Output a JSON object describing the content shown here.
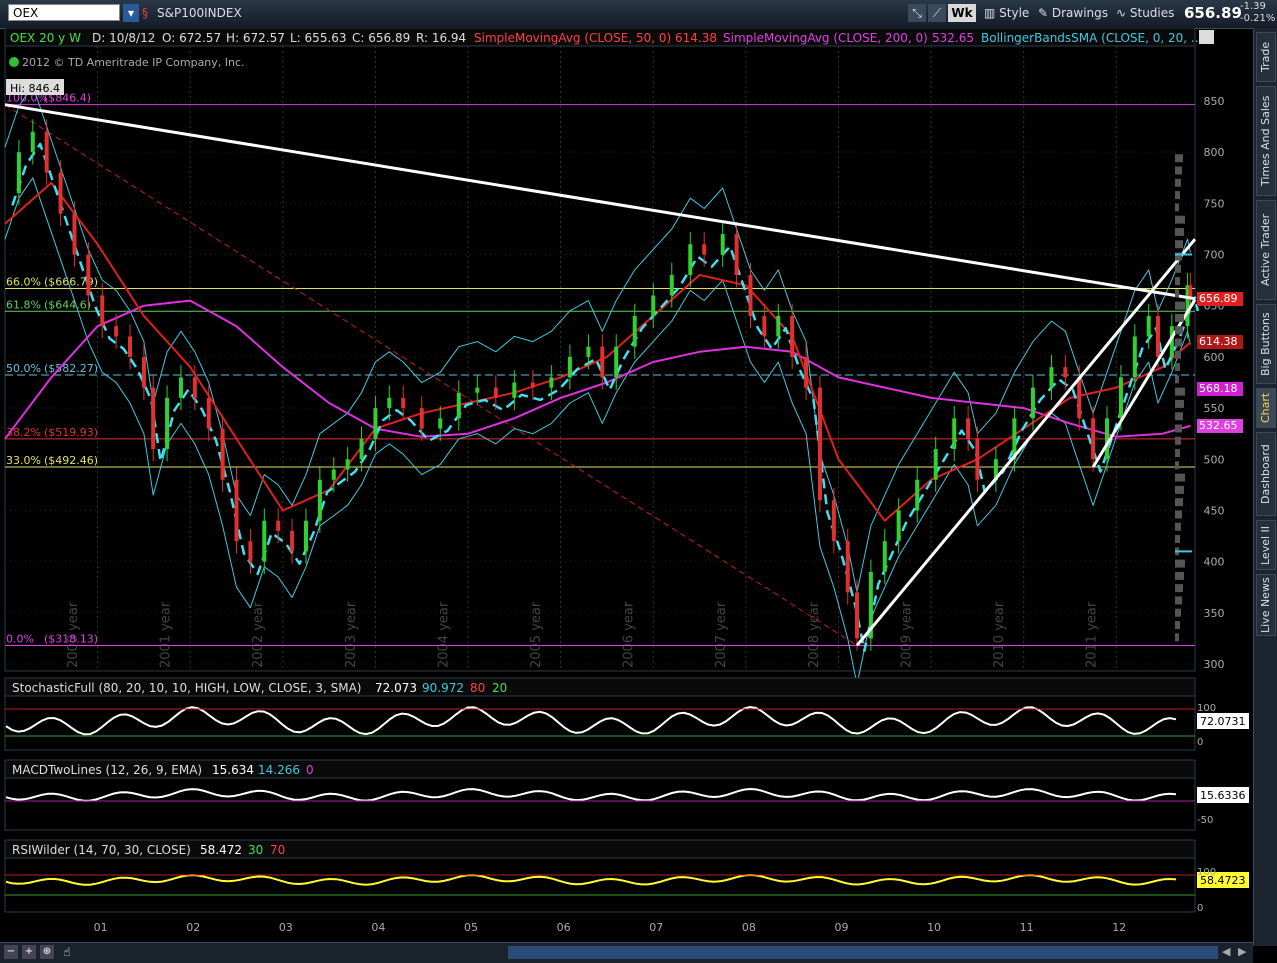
{
  "toolbar": {
    "symbol": "OEX",
    "description": "S&P100INDEX",
    "wk_label": "Wk",
    "style_label": "Style",
    "drawings_label": "Drawings",
    "studies_label": "Studies",
    "last_price": "656.89",
    "change": "-1.39",
    "change_pct": "-0.21%"
  },
  "header": {
    "title": "OEX 20 y W",
    "date": "D: 10/8/12",
    "open": "O: 672.57",
    "high": "H: 672.57",
    "low": "L: 655.63",
    "close": "C: 656.89",
    "range": "R: 16.94",
    "sma50_label": "SimpleMovingAvg (CLOSE, 50, 0)",
    "sma50_value": "614.38",
    "sma200_label": "SimpleMovingAvg (CLOSE, 200, 0)",
    "sma200_value": "532.65",
    "bb_label": "BollingerBandsSMA (CLOSE, 0, 20, ...",
    "copyright": "2012 © TD Ameritrade IP Company, Inc.",
    "hi_label": "Hi: 846.4"
  },
  "fib_levels": [
    {
      "label": "100.0%",
      "value": "($846.4)",
      "price": 846.4,
      "color": "#e040e0"
    },
    {
      "label": "66.0%",
      "value": "($666.79)",
      "price": 666.79,
      "color": "#e0e060"
    },
    {
      "label": "61.8%",
      "value": "($644.6)",
      "price": 644.6,
      "color": "#60d060"
    },
    {
      "label": "50.0%",
      "value": "($582.27)",
      "price": 582.27,
      "color": "#60c0e0"
    },
    {
      "label": "38.2%",
      "value": "($519.93)",
      "price": 519.93,
      "color": "#e03030"
    },
    {
      "label": "33.0%",
      "value": "($492.46)",
      "price": 492.46,
      "color": "#e0e060"
    },
    {
      "label": "0.0%",
      "value": "($318.13)",
      "price": 318.13,
      "color": "#e040e0"
    }
  ],
  "price_tags": [
    {
      "text": "656.89",
      "price": 656.89,
      "bg": "#e02020",
      "fg": "#ffffff"
    },
    {
      "text": "614.38",
      "price": 614.38,
      "bg": "#b01818",
      "fg": "#ffffff"
    },
    {
      "text": "568.18",
      "price": 568.18,
      "bg": "#d020d0",
      "fg": "#ffffff"
    },
    {
      "text": "532.65",
      "price": 532.65,
      "bg": "#e040e0",
      "fg": "#ffffff"
    }
  ],
  "chart_data": {
    "type": "line",
    "title": "OEX 20 y W",
    "y_ticks": [
      850,
      800,
      750,
      700,
      650,
      600,
      550,
      500,
      450,
      400,
      350,
      300
    ],
    "ylim": [
      300,
      880
    ],
    "year_labels": [
      "2000 year",
      "2001 year",
      "2002 year",
      "2003 year",
      "2004 year",
      "2005 year",
      "2006 year",
      "2007 year",
      "2008 year",
      "2009 year",
      "2010 year",
      "2011 year"
    ],
    "x_tick_labels": [
      "01",
      "02",
      "03",
      "04",
      "05",
      "06",
      "07",
      "08",
      "09",
      "10",
      "11",
      "12"
    ],
    "xlim": [
      2000,
      2012.85
    ],
    "close_series": [
      {
        "x": 2000.0,
        "y": 760
      },
      {
        "x": 2000.15,
        "y": 800
      },
      {
        "x": 2000.3,
        "y": 820
      },
      {
        "x": 2000.45,
        "y": 780
      },
      {
        "x": 2000.6,
        "y": 740
      },
      {
        "x": 2000.75,
        "y": 700
      },
      {
        "x": 2000.9,
        "y": 660
      },
      {
        "x": 2001.05,
        "y": 630
      },
      {
        "x": 2001.2,
        "y": 620
      },
      {
        "x": 2001.35,
        "y": 600
      },
      {
        "x": 2001.5,
        "y": 570
      },
      {
        "x": 2001.6,
        "y": 510
      },
      {
        "x": 2001.75,
        "y": 560
      },
      {
        "x": 2001.9,
        "y": 580
      },
      {
        "x": 2002.05,
        "y": 560
      },
      {
        "x": 2002.2,
        "y": 530
      },
      {
        "x": 2002.35,
        "y": 480
      },
      {
        "x": 2002.5,
        "y": 420
      },
      {
        "x": 2002.65,
        "y": 400
      },
      {
        "x": 2002.8,
        "y": 440
      },
      {
        "x": 2002.95,
        "y": 430
      },
      {
        "x": 2003.1,
        "y": 410
      },
      {
        "x": 2003.25,
        "y": 440
      },
      {
        "x": 2003.4,
        "y": 480
      },
      {
        "x": 2003.55,
        "y": 490
      },
      {
        "x": 2003.7,
        "y": 500
      },
      {
        "x": 2003.85,
        "y": 520
      },
      {
        "x": 2004.0,
        "y": 550
      },
      {
        "x": 2004.15,
        "y": 560
      },
      {
        "x": 2004.3,
        "y": 550
      },
      {
        "x": 2004.5,
        "y": 530
      },
      {
        "x": 2004.7,
        "y": 540
      },
      {
        "x": 2004.9,
        "y": 565
      },
      {
        "x": 2005.1,
        "y": 570
      },
      {
        "x": 2005.3,
        "y": 560
      },
      {
        "x": 2005.5,
        "y": 575
      },
      {
        "x": 2005.7,
        "y": 570
      },
      {
        "x": 2005.9,
        "y": 580
      },
      {
        "x": 2006.1,
        "y": 600
      },
      {
        "x": 2006.3,
        "y": 610
      },
      {
        "x": 2006.45,
        "y": 580
      },
      {
        "x": 2006.6,
        "y": 610
      },
      {
        "x": 2006.8,
        "y": 640
      },
      {
        "x": 2007.0,
        "y": 660
      },
      {
        "x": 2007.2,
        "y": 680
      },
      {
        "x": 2007.4,
        "y": 710
      },
      {
        "x": 2007.55,
        "y": 700
      },
      {
        "x": 2007.75,
        "y": 720
      },
      {
        "x": 2007.9,
        "y": 680
      },
      {
        "x": 2008.05,
        "y": 640
      },
      {
        "x": 2008.2,
        "y": 620
      },
      {
        "x": 2008.35,
        "y": 640
      },
      {
        "x": 2008.5,
        "y": 600
      },
      {
        "x": 2008.65,
        "y": 570
      },
      {
        "x": 2008.8,
        "y": 460
      },
      {
        "x": 2008.95,
        "y": 420
      },
      {
        "x": 2009.1,
        "y": 370
      },
      {
        "x": 2009.2,
        "y": 325
      },
      {
        "x": 2009.35,
        "y": 390
      },
      {
        "x": 2009.5,
        "y": 420
      },
      {
        "x": 2009.65,
        "y": 450
      },
      {
        "x": 2009.85,
        "y": 480
      },
      {
        "x": 2010.05,
        "y": 510
      },
      {
        "x": 2010.25,
        "y": 540
      },
      {
        "x": 2010.4,
        "y": 520
      },
      {
        "x": 2010.5,
        "y": 480
      },
      {
        "x": 2010.7,
        "y": 500
      },
      {
        "x": 2010.9,
        "y": 540
      },
      {
        "x": 2011.1,
        "y": 570
      },
      {
        "x": 2011.3,
        "y": 590
      },
      {
        "x": 2011.45,
        "y": 580
      },
      {
        "x": 2011.6,
        "y": 540
      },
      {
        "x": 2011.75,
        "y": 500
      },
      {
        "x": 2011.9,
        "y": 540
      },
      {
        "x": 2012.05,
        "y": 580
      },
      {
        "x": 2012.2,
        "y": 620
      },
      {
        "x": 2012.35,
        "y": 640
      },
      {
        "x": 2012.45,
        "y": 600
      },
      {
        "x": 2012.6,
        "y": 630
      },
      {
        "x": 2012.77,
        "y": 670
      },
      {
        "x": 2012.8,
        "y": 656.89
      }
    ],
    "sma50_series": [
      {
        "x": 2000.0,
        "y": 730
      },
      {
        "x": 2000.5,
        "y": 770
      },
      {
        "x": 2001.0,
        "y": 710
      },
      {
        "x": 2001.5,
        "y": 640
      },
      {
        "x": 2002.0,
        "y": 590
      },
      {
        "x": 2002.5,
        "y": 520
      },
      {
        "x": 2003.0,
        "y": 450
      },
      {
        "x": 2003.5,
        "y": 470
      },
      {
        "x": 2004.0,
        "y": 530
      },
      {
        "x": 2004.5,
        "y": 545
      },
      {
        "x": 2005.0,
        "y": 555
      },
      {
        "x": 2005.5,
        "y": 565
      },
      {
        "x": 2006.0,
        "y": 580
      },
      {
        "x": 2006.5,
        "y": 600
      },
      {
        "x": 2007.0,
        "y": 640
      },
      {
        "x": 2007.5,
        "y": 680
      },
      {
        "x": 2008.0,
        "y": 670
      },
      {
        "x": 2008.5,
        "y": 620
      },
      {
        "x": 2009.0,
        "y": 500
      },
      {
        "x": 2009.5,
        "y": 440
      },
      {
        "x": 2010.0,
        "y": 480
      },
      {
        "x": 2010.5,
        "y": 500
      },
      {
        "x": 2011.0,
        "y": 530
      },
      {
        "x": 2011.5,
        "y": 560
      },
      {
        "x": 2012.0,
        "y": 570
      },
      {
        "x": 2012.5,
        "y": 590
      },
      {
        "x": 2012.8,
        "y": 614.38
      }
    ],
    "sma200_series": [
      {
        "x": 2000.0,
        "y": 520
      },
      {
        "x": 2000.5,
        "y": 580
      },
      {
        "x": 2001.0,
        "y": 630
      },
      {
        "x": 2001.5,
        "y": 650
      },
      {
        "x": 2002.0,
        "y": 655
      },
      {
        "x": 2002.5,
        "y": 630
      },
      {
        "x": 2003.0,
        "y": 590
      },
      {
        "x": 2003.5,
        "y": 555
      },
      {
        "x": 2004.0,
        "y": 530
      },
      {
        "x": 2004.5,
        "y": 522
      },
      {
        "x": 2005.0,
        "y": 525
      },
      {
        "x": 2005.5,
        "y": 540
      },
      {
        "x": 2006.0,
        "y": 560
      },
      {
        "x": 2006.5,
        "y": 575
      },
      {
        "x": 2007.0,
        "y": 595
      },
      {
        "x": 2007.5,
        "y": 605
      },
      {
        "x": 2008.0,
        "y": 610
      },
      {
        "x": 2008.5,
        "y": 605
      },
      {
        "x": 2009.0,
        "y": 580
      },
      {
        "x": 2009.5,
        "y": 570
      },
      {
        "x": 2010.0,
        "y": 560
      },
      {
        "x": 2010.5,
        "y": 555
      },
      {
        "x": 2011.0,
        "y": 550
      },
      {
        "x": 2011.5,
        "y": 535
      },
      {
        "x": 2012.0,
        "y": 522
      },
      {
        "x": 2012.5,
        "y": 525
      },
      {
        "x": 2012.8,
        "y": 532.65
      }
    ],
    "trendlines": [
      {
        "x1": 2000.0,
        "y1": 846.4,
        "x2": 2012.85,
        "y2": 656.89
      },
      {
        "x1": 2009.2,
        "y1": 318.13,
        "x2": 2012.85,
        "y2": 715
      },
      {
        "x1": 2011.75,
        "y1": 492.46,
        "x2": 2012.85,
        "y2": 656
      }
    ],
    "studies": {
      "stochastic": {
        "label": "StochasticFull (80, 20, 10, 10, HIGH, LOW, CLOSE, 3, SMA)",
        "k": "72.073",
        "d": "90.972",
        "over": "80",
        "under": "20",
        "tag": "72.0731",
        "ticks": [
          "100",
          "0"
        ]
      },
      "macd": {
        "label": "MACDTwoLines (12, 26, 9, EMA)",
        "value": "15.634",
        "avg": "14.266",
        "zero": "0",
        "tag": "15.6336",
        "ticks": [
          "-50"
        ]
      },
      "rsi": {
        "label": "RSIWilder (14, 70, 30, CLOSE)",
        "value": "58.472",
        "over": "30",
        "under": "70",
        "tag": "58.4723",
        "ticks": [
          "100",
          "0"
        ]
      }
    }
  },
  "sidebar": {
    "tabs": [
      "Trade",
      "Times And Sales",
      "Active Trader",
      "Big Buttons",
      "Chart",
      "Dashboard",
      "Level II",
      "Live News"
    ],
    "active": "Chart"
  }
}
